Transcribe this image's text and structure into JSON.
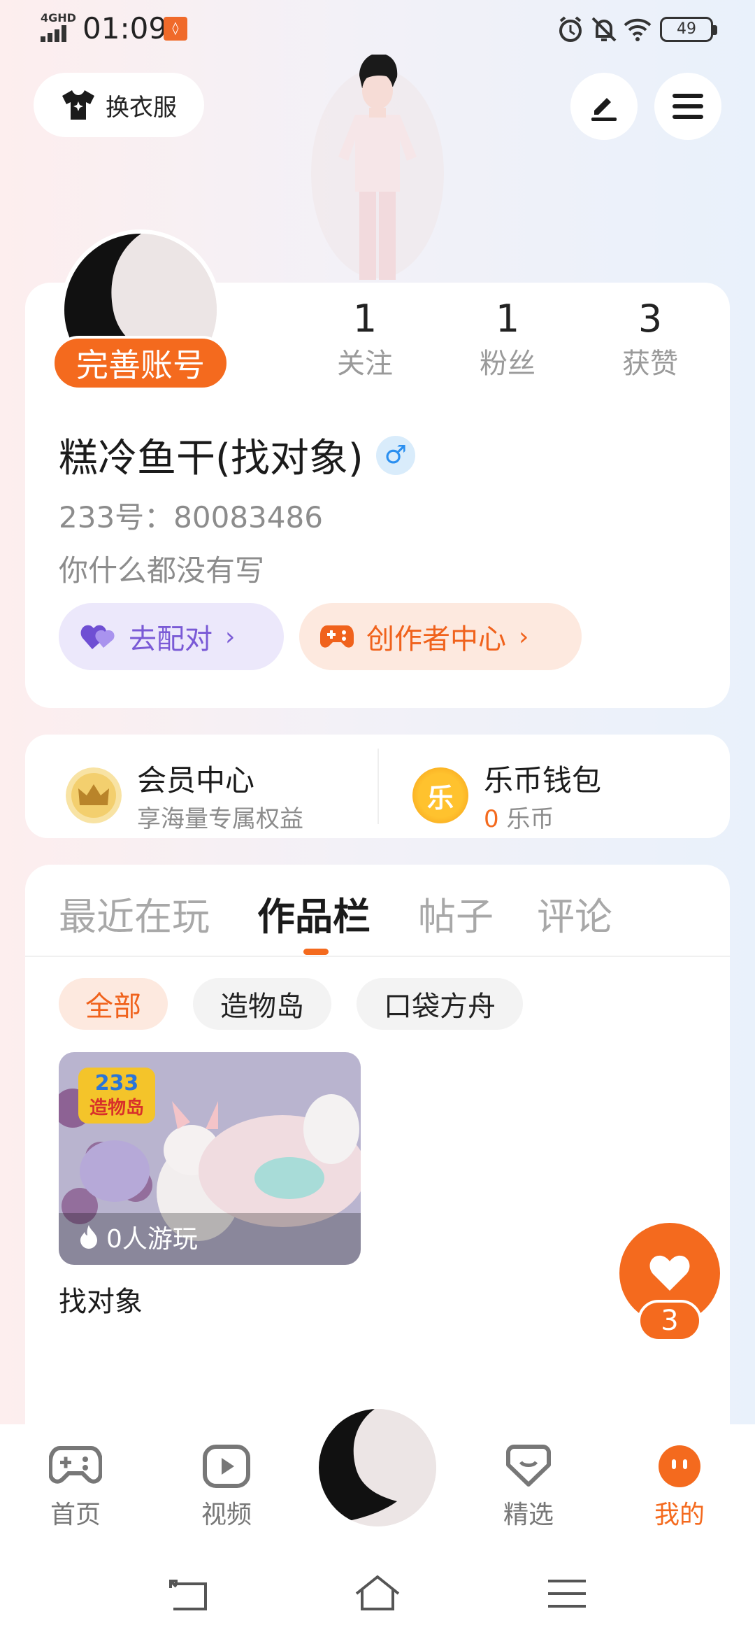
{
  "status_bar": {
    "network": "4GHD",
    "time": "01:09",
    "battery": "49"
  },
  "header": {
    "outfit_button": "换衣服"
  },
  "profile": {
    "complete_badge": "完善账号",
    "stats": [
      {
        "value": "1",
        "label": "关注"
      },
      {
        "value": "1",
        "label": "粉丝"
      },
      {
        "value": "3",
        "label": "获赞"
      }
    ],
    "name": "糕冷鱼干(找对象)",
    "gender_symbol": "♂",
    "uid": "233号：80083486",
    "bio": "你什么都没有写",
    "match_button": "去配对",
    "creator_button": "创作者中心"
  },
  "member": {
    "title": "会员中心",
    "subtitle": "享海量专属权益"
  },
  "wallet": {
    "title": "乐币钱包",
    "coin_char": "乐",
    "amount": "0",
    "unit": "乐币"
  },
  "tabs": [
    "最近在玩",
    "作品栏",
    "帖子",
    "评论"
  ],
  "active_tab": "作品栏",
  "filters": [
    "全部",
    "造物岛",
    "口袋方舟"
  ],
  "work": {
    "badge_top": "233",
    "badge_bottom": "造物岛",
    "plays": "0人游玩",
    "title": "找对象"
  },
  "like_count": "3",
  "bottom_nav": [
    {
      "label": "首页",
      "icon": "gamepad-icon"
    },
    {
      "label": "视频",
      "icon": "play-icon"
    },
    {
      "label": "精选",
      "icon": "heart-badge-icon"
    },
    {
      "label": "我的",
      "icon": "face-icon"
    }
  ],
  "colors": {
    "accent": "#f46a1e",
    "match_purple": "#7a5ad6",
    "gender_blue": "#2a8ff0"
  }
}
